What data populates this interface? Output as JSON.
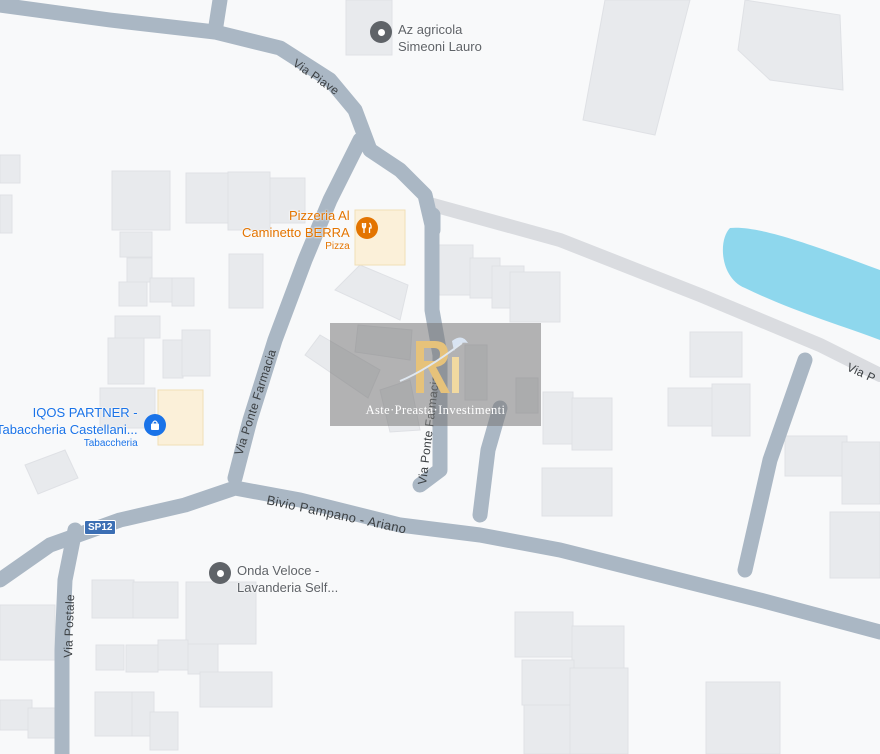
{
  "map": {
    "colors": {
      "background": "#f8f9fa",
      "building": "#e8eaed",
      "road": "#aab7c4",
      "minor_road": "#dadce0",
      "water": "#8ed7ed",
      "pin_gray": "#5f6368",
      "food_orange": "#e37400",
      "shop_blue": "#1a73e8"
    },
    "roads": {
      "via_piave": "Via Piave",
      "via_ponte_farmacia_1": "Via Ponte Farmacia",
      "via_ponte_farmacia_2": "Via Ponte Farmacia",
      "bivio": "Bivio Pampano - Ariano",
      "via_postale": "Via Postale",
      "edge_label": "Via P"
    },
    "route_shield": "SP12",
    "pois": {
      "agricola": {
        "line1": "Az agricola",
        "line2": "Simeoni Lauro",
        "icon": "map-pin-icon"
      },
      "pizzeria": {
        "line1": "Pizzeria Al",
        "line2": "Caminetto BERRA",
        "sub": "Pizza",
        "icon": "fork-knife-icon"
      },
      "iqos": {
        "line1": "IQOS PARTNER -",
        "line2": "Tabaccheria Castellani...",
        "sub": "Tabaccheria",
        "icon": "shopping-bag-icon"
      },
      "onda": {
        "line1": "Onda Veloce -",
        "line2": "Lavanderia Self...",
        "icon": "map-pin-icon"
      }
    },
    "watermark": {
      "text": "Aste·Preasta·Investimenti",
      "logo": "ri-logo-icon"
    }
  }
}
